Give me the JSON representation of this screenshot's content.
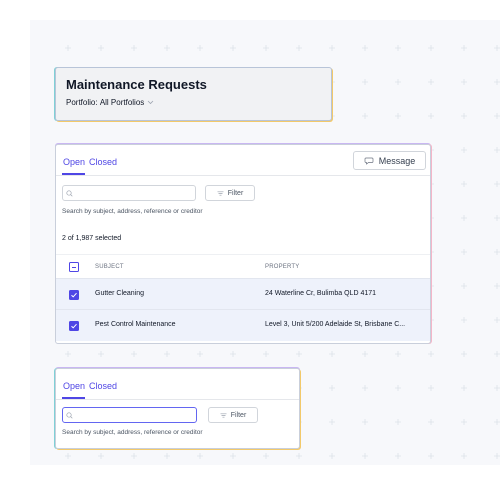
{
  "header": {
    "title": "Maintenance Requests",
    "portfolio_label": "Portfolio:",
    "portfolio_value": "All Portfolios"
  },
  "list": {
    "tabs": [
      {
        "label": "Open",
        "active": true
      },
      {
        "label": "Closed",
        "active": false
      }
    ],
    "message_button": "Message",
    "search": {
      "value": "",
      "placeholder": ""
    },
    "filter_label": "Filter",
    "search_hint": "Search by subject, address, reference or creditor",
    "selection_count": "2 of 1,987 selected",
    "columns": [
      "SUBJECT",
      "PROPERTY"
    ],
    "rows": [
      {
        "subject": "Gutter Cleaning",
        "property": "24 Waterline Cr, Bulimba QLD 4171",
        "checked": true
      },
      {
        "subject": "Pest Control Maintenance",
        "property": "Level 3, Unit 5/200 Adelaide St, Brisbane C...",
        "checked": true
      }
    ]
  },
  "mini": {
    "tabs": [
      {
        "label": "Open",
        "active": true
      },
      {
        "label": "Closed",
        "active": false
      }
    ],
    "filter_label": "Filter",
    "search": {
      "value": "",
      "placeholder": ""
    },
    "search_hint": "Search by subject, address, reference or creditor"
  },
  "colors": {
    "accent": "#4f46e5",
    "row_selected": "#eef2fb",
    "canvas": "#f7f8fb"
  },
  "icons": {
    "message": "speech-bubble-icon",
    "filter": "filter-lines-icon",
    "search": "magnifier-icon",
    "check": "checkmark-icon"
  }
}
